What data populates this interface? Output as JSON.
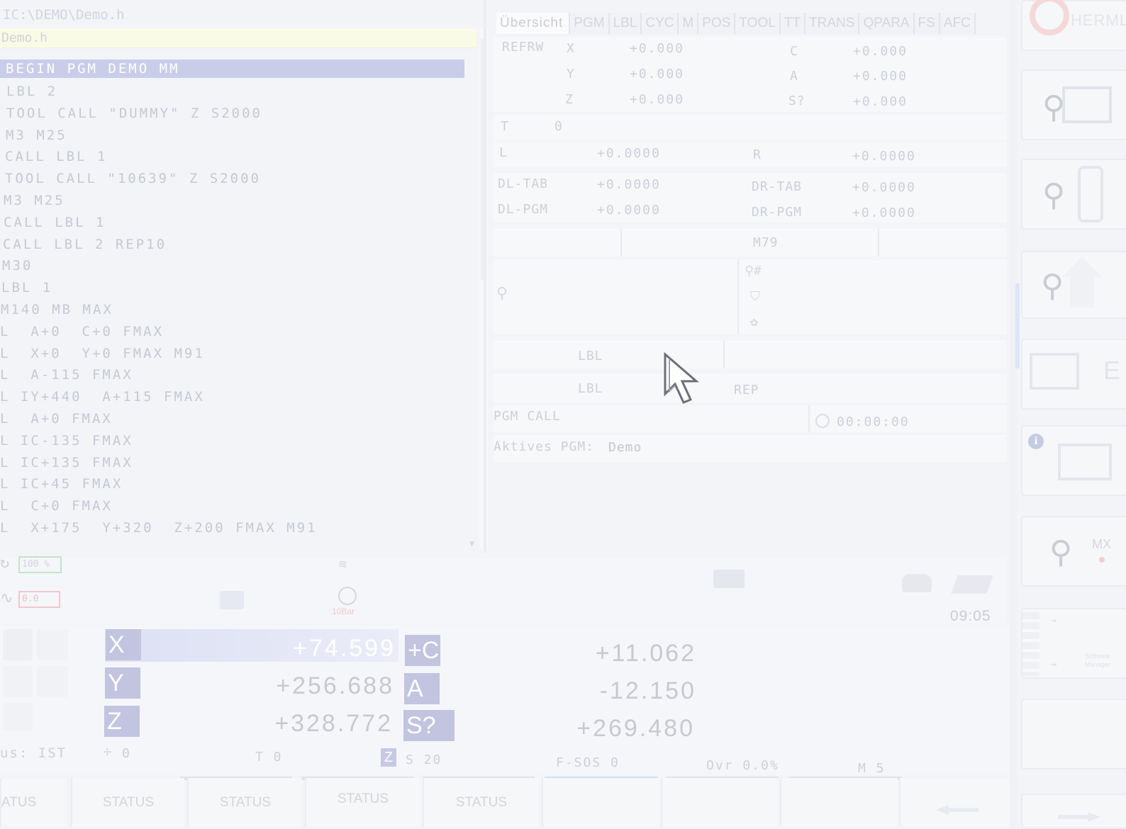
{
  "program": {
    "path": "IC:\\DEMO\\Demo.h",
    "file": "Demo.h",
    "lines": [
      "BEGIN PGM DEMO MM",
      "LBL 2",
      "TOOL CALL \"DUMMY\" Z S2000",
      "M3 M25",
      "CALL LBL 1",
      "TOOL CALL \"10639\" Z S2000",
      "M3 M25",
      "CALL LBL 1",
      "CALL LBL 2 REP10",
      "M30",
      "LBL 1",
      "M140 MB MAX",
      "L  A+0  C+0 FMAX",
      "L  X+0  Y+0 FMAX M91",
      "L  A-115 FMAX",
      "L IY+440  A+115 FMAX",
      "L  A+0 FMAX",
      "L IC-135 FMAX",
      "L IC+135 FMAX",
      "L IC+45 FMAX",
      "L  C+0 FMAX",
      "L  X+175  Y+320  Z+200 FMAX M91"
    ]
  },
  "tabs": [
    "Übersicht",
    "PGM",
    "LBL",
    "CYC",
    "M",
    "POS",
    "TOOL",
    "TT",
    "TRANS",
    "QPARA",
    "FS",
    "AFC"
  ],
  "overview": {
    "refrw_label": "REFRW",
    "ref": [
      {
        "axis": "X",
        "value": "+0.000"
      },
      {
        "axis": "Y",
        "value": "+0.000"
      },
      {
        "axis": "Z",
        "value": "+0.000"
      },
      {
        "axis": "C",
        "value": "+0.000"
      },
      {
        "axis": "A",
        "value": "+0.000"
      },
      {
        "axis": "S?",
        "value": "+0.000"
      }
    ],
    "tool_label": "T",
    "tool_value": "0",
    "l_label": "L",
    "l_value": "+0.0000",
    "r_label": "R",
    "r_value": "+0.0000",
    "dl_tab_label": "DL-TAB",
    "dl_tab_value": "+0.0000",
    "dr_tab_label": "DR-TAB",
    "dr_tab_value": "+0.0000",
    "dl_pgm_label": "DL-PGM",
    "dl_pgm_value": "+0.0000",
    "dr_pgm_label": "DR-PGM",
    "dr_pgm_value": "+0.0000",
    "m_function": "M79",
    "lbl1": "LBL",
    "lbl2": "LBL",
    "rep": "REP",
    "pgm_call": "PGM CALL",
    "timer": "00:00:00",
    "active_pgm_label": "Aktives PGM:",
    "active_pgm": "Demo"
  },
  "machine": {
    "feed_override": "100 %",
    "spindle_override": "0.0",
    "pressure": "10Bar",
    "clock": "09:05"
  },
  "positions": [
    {
      "axis": "X",
      "value": "+74.599"
    },
    {
      "axis": "Y",
      "value": "+256.688"
    },
    {
      "axis": "Z",
      "value": "+328.772"
    },
    {
      "axis": "+C",
      "value": "+11.062"
    },
    {
      "axis": "A",
      "value": "-12.150"
    },
    {
      "axis": "S?",
      "value": "+269.480"
    }
  ],
  "status_line": {
    "mode": "us: IST",
    "dir": "0",
    "tool": "T 0",
    "z_tag": "Z",
    "spindle": "S 20",
    "feed": "F-SOS 0",
    "ovr": "Ovr 0.0%",
    "m": "M 5"
  },
  "softkeys": [
    "ATUS",
    "STATUS",
    "STATUS",
    "STATUS",
    "STATUS"
  ],
  "sidebar": {
    "brand": "HERMLE",
    "keys": [
      {
        "icon": "person-machine-icon"
      },
      {
        "icon": "person-tool-change-icon"
      },
      {
        "icon": "person-home-icon"
      },
      {
        "icon": "machine-table-icon"
      },
      {
        "icon": "info-machine-icon"
      },
      {
        "icon": "person-mx-icon",
        "label": "MX"
      },
      {
        "icon": "software-manager-icon",
        "label": "Software Manager"
      }
    ]
  }
}
